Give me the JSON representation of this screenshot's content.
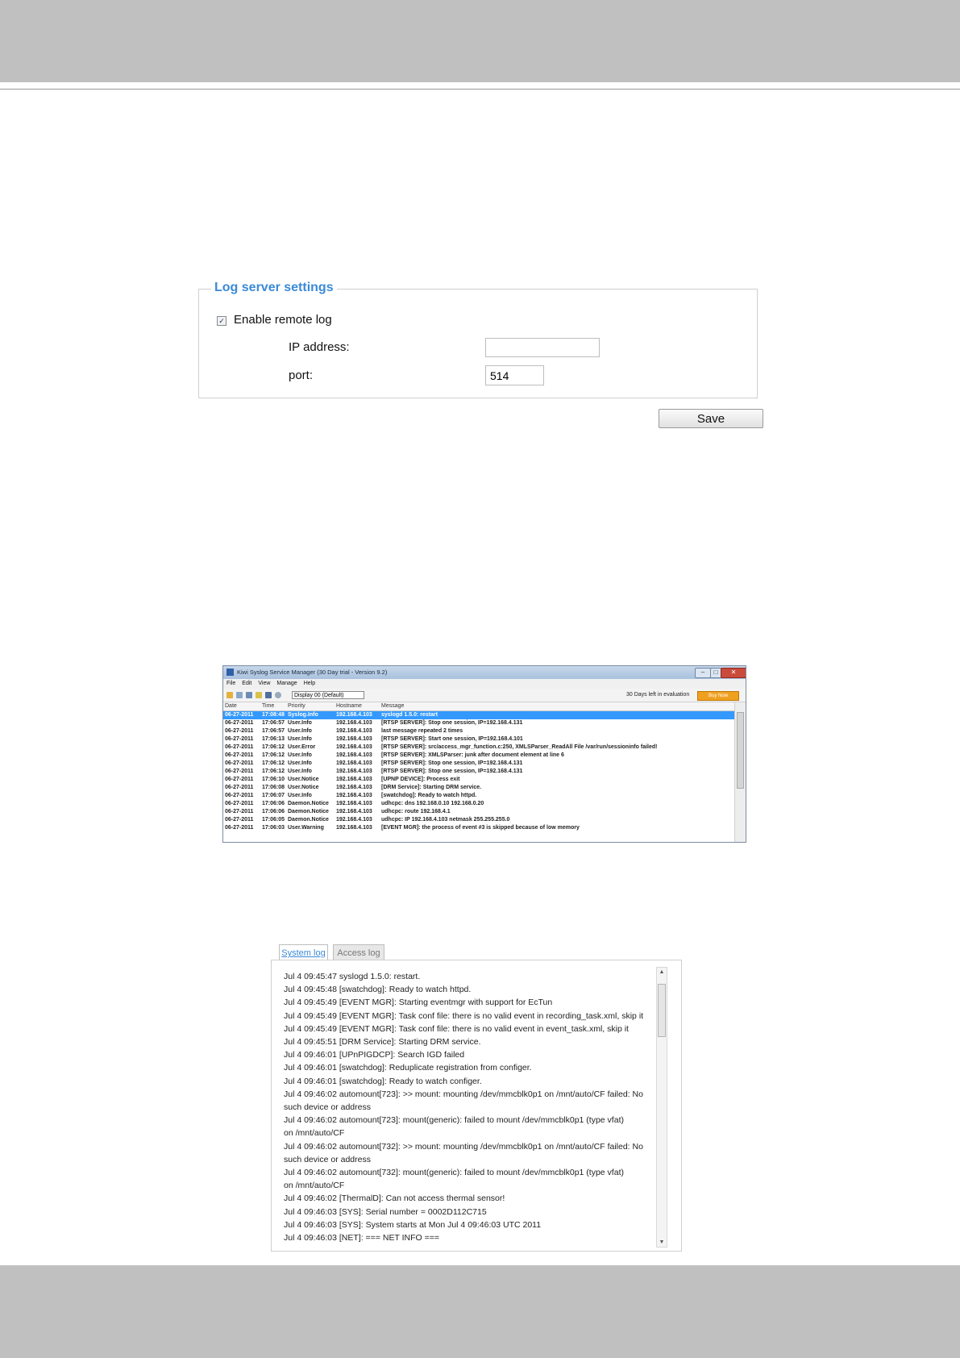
{
  "log_server": {
    "legend": "Log server settings",
    "enable_checked": true,
    "enable_label": "Enable remote log",
    "ip_label": "IP address:",
    "ip_value": "",
    "port_label": "port:",
    "port_value": "514",
    "save_label": "Save"
  },
  "syslog_window": {
    "title": "Kiwi Syslog Service Manager (30 Day trial - Version 9.2)",
    "menu": [
      "File",
      "Edit",
      "View",
      "Manage",
      "Help"
    ],
    "display_select": "Display 00 (Default)",
    "eval_text": "30 Days left in evaluation",
    "buy_label": "Buy Now",
    "columns": [
      "Date",
      "Time",
      "Priority",
      "Hostname",
      "Message"
    ],
    "rows": [
      [
        "06-27-2011",
        "17:08:48",
        "Syslog.Info",
        "192.168.4.103",
        "syslogd 1.5.0: restart"
      ],
      [
        "06-27-2011",
        "17:06:57",
        "User.Info",
        "192.168.4.103",
        "[RTSP SERVER]: Stop one session, IP=192.168.4.131"
      ],
      [
        "06-27-2011",
        "17:06:57",
        "User.Info",
        "192.168.4.103",
        "last message repeated 2 times"
      ],
      [
        "06-27-2011",
        "17:06:13",
        "User.Info",
        "192.168.4.103",
        "[RTSP SERVER]: Start one session, IP=192.168.4.101"
      ],
      [
        "06-27-2011",
        "17:06:12",
        "User.Error",
        "192.168.4.103",
        "[RTSP SERVER]: src/access_mgr_function.c:250, XMLSParser_ReadAll File /var/run/sessioninfo failed!"
      ],
      [
        "06-27-2011",
        "17:06:12",
        "User.Info",
        "192.168.4.103",
        "[RTSP SERVER]: XMLSParser: junk after document element at line 6"
      ],
      [
        "06-27-2011",
        "17:06:12",
        "User.Info",
        "192.168.4.103",
        "[RTSP SERVER]: Stop one session, IP=192.168.4.131"
      ],
      [
        "06-27-2011",
        "17:06:12",
        "User.Info",
        "192.168.4.103",
        "[RTSP SERVER]: Stop one session, IP=192.168.4.131"
      ],
      [
        "06-27-2011",
        "17:06:10",
        "User.Notice",
        "192.168.4.103",
        "[UPNP DEVICE]: Process exit"
      ],
      [
        "06-27-2011",
        "17:06:08",
        "User.Notice",
        "192.168.4.103",
        "[DRM Service]: Starting DRM service."
      ],
      [
        "06-27-2011",
        "17:06:07",
        "User.Info",
        "192.168.4.103",
        "[swatchdog]: Ready to watch httpd."
      ],
      [
        "06-27-2011",
        "17:06:06",
        "Daemon.Notice",
        "192.168.4.103",
        "udhcpc: dns 192.168.0.10 192.168.0.20"
      ],
      [
        "06-27-2011",
        "17:06:06",
        "Daemon.Notice",
        "192.168.4.103",
        "udhcpc: route 192.168.4.1"
      ],
      [
        "06-27-2011",
        "17:06:05",
        "Daemon.Notice",
        "192.168.4.103",
        "udhcpc: IP 192.168.4.103 netmask 255.255.255.0"
      ],
      [
        "06-27-2011",
        "17:06:03",
        "User.Warning",
        "192.168.4.103",
        "[EVENT MGR]: the process of event #3 is skipped because of low memory"
      ]
    ]
  },
  "system_log": {
    "tabs": [
      "System log",
      "Access log"
    ],
    "active_tab": "System log",
    "lines": [
      "Jul 4 09:45:47 syslogd 1.5.0: restart.",
      "Jul 4 09:45:48 [swatchdog]: Ready to watch httpd.",
      "Jul 4 09:45:49 [EVENT MGR]: Starting eventmgr with support for EcTun",
      "Jul 4 09:45:49 [EVENT MGR]: Task conf file: there is no valid event in recording_task.xml, skip it",
      "Jul 4 09:45:49 [EVENT MGR]: Task conf file: there is no valid event in event_task.xml, skip it",
      "Jul 4 09:45:51 [DRM Service]: Starting DRM service.",
      "Jul 4 09:46:01 [UPnPIGDCP]: Search IGD failed",
      "Jul 4 09:46:01 [swatchdog]: Reduplicate registration from configer.",
      "Jul 4 09:46:01 [swatchdog]: Ready to watch configer.",
      "Jul 4 09:46:02 automount[723]: >> mount: mounting /dev/mmcblk0p1 on /mnt/auto/CF failed: No",
      "such device or address",
      "Jul 4 09:46:02 automount[723]: mount(generic): failed to mount /dev/mmcblk0p1 (type vfat)",
      "on /mnt/auto/CF",
      "Jul 4 09:46:02 automount[732]: >> mount: mounting /dev/mmcblk0p1 on /mnt/auto/CF failed: No",
      "such device or address",
      "Jul 4 09:46:02 automount[732]: mount(generic): failed to mount /dev/mmcblk0p1 (type vfat)",
      "on /mnt/auto/CF",
      "Jul 4 09:46:02 [ThermalD]: Can not access thermal sensor!",
      "Jul 4 09:46:03 [SYS]: Serial number = 0002D112C715",
      "Jul 4 09:46:03 [SYS]: System starts at Mon Jul 4 09:46:03 UTC 2011",
      "Jul 4 09:46:03 [NET]: === NET INFO ==="
    ]
  },
  "colors": {
    "legend_blue": "#3a8ad8",
    "band_gray": "#c0c0c0",
    "selection_blue": "#3399ff",
    "buy_orange": "#f0a020"
  }
}
